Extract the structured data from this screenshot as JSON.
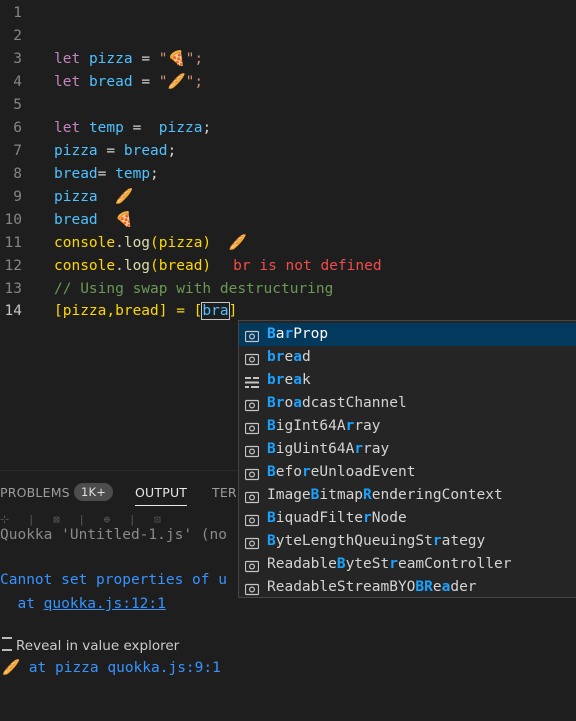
{
  "editor": {
    "active_line": "14",
    "lines": [
      {
        "n": "1"
      },
      {
        "n": "2"
      },
      {
        "n": "3",
        "t": [
          "let",
          "pizza",
          "=",
          "\"",
          "🍕",
          "\";"
        ]
      },
      {
        "n": "4",
        "t": [
          "let",
          "bread",
          "=",
          "\"",
          "🥖",
          "\";"
        ]
      },
      {
        "n": "5"
      },
      {
        "n": "6",
        "t": [
          "let",
          "temp",
          "=",
          "pizza",
          ";"
        ]
      },
      {
        "n": "7",
        "t": [
          "pizza",
          "=",
          "bread",
          ";"
        ]
      },
      {
        "n": "8",
        "t": [
          "bread",
          "=",
          "temp",
          ";"
        ]
      },
      {
        "n": "9",
        "t": [
          "pizza",
          "🥖"
        ]
      },
      {
        "n": "10",
        "t": [
          "bread",
          "🍕"
        ]
      },
      {
        "n": "11",
        "t": [
          "console",
          ".",
          "log",
          "(pizza)",
          "🥖"
        ]
      },
      {
        "n": "12",
        "t": [
          "console",
          ".",
          "log",
          "(bread)",
          "br is not defined"
        ]
      },
      {
        "n": "13",
        "t": [
          "// Using swap with destructuring"
        ]
      },
      {
        "n": "14",
        "t": [
          "[pizza,bread] = [",
          "bra",
          "]"
        ]
      }
    ]
  },
  "suggest": {
    "items": [
      {
        "icon": "symbol-variable-icon",
        "pre": "",
        "hl1": "B",
        "mid1": "a",
        "hl2": "r",
        "rest": "Prop"
      },
      {
        "icon": "symbol-variable-icon",
        "pre": "",
        "hl1": "br",
        "mid1": "e",
        "hl2": "a",
        "rest": "d"
      },
      {
        "icon": "symbol-keyword-icon",
        "pre": "",
        "hl1": "br",
        "mid1": "e",
        "hl2": "a",
        "rest": "k"
      },
      {
        "icon": "symbol-variable-icon",
        "pre": "",
        "hl1": "Br",
        "mid1": "o",
        "hl2": "a",
        "rest": "dcastChannel"
      },
      {
        "icon": "symbol-variable-icon",
        "pre": "",
        "hl1": "B",
        "mid1": "igInt64A",
        "hl2": "r",
        "rest": "ray"
      },
      {
        "icon": "symbol-variable-icon",
        "pre": "",
        "hl1": "B",
        "mid1": "igUint64A",
        "hl2": "r",
        "rest": "ray"
      },
      {
        "icon": "symbol-variable-icon",
        "pre": "",
        "hl1": "B",
        "mid1": "efo",
        "hl2": "r",
        "rest": "eUnloadEvent"
      },
      {
        "icon": "symbol-variable-icon",
        "pre": "Image",
        "hl1": "B",
        "mid1": "itmap",
        "hl2": "R",
        "rest": "enderingContext"
      },
      {
        "icon": "symbol-variable-icon",
        "pre": "",
        "hl1": "B",
        "mid1": "iquadFilte",
        "hl2": "r",
        "rest": "Node"
      },
      {
        "icon": "symbol-variable-icon",
        "pre": "",
        "hl1": "B",
        "mid1": "yteLengthQueuingSt",
        "hl2": "r",
        "rest": "ategy"
      },
      {
        "icon": "symbol-variable-icon",
        "pre": "Readable",
        "hl1": "B",
        "mid1": "yteSt",
        "hl2": "r",
        "rest": "eamController"
      },
      {
        "icon": "symbol-variable-icon",
        "pre": "ReadableStreamBYO",
        "hl1": "BR",
        "mid1": "e",
        "hl2": "a",
        "rest": "der"
      }
    ]
  },
  "panel": {
    "tabs": {
      "problems": "PROBLEMS",
      "problems_count": "1K+",
      "output": "OUTPUT",
      "terminal": "TERM"
    },
    "toolbar_glyphs": "⊹ | ⊠ | ⊕ | ⊡",
    "lines": {
      "quokka": "Quokka 'Untitled-1.js' (no",
      "error": "Cannot set properties of u",
      "at_prefix": "  at ",
      "at_link": "quokka.js:12:1",
      "reveal": "Reveal in value explorer",
      "emoji": "🥖",
      "trace": " at pizza quokka.js:9:1"
    }
  }
}
